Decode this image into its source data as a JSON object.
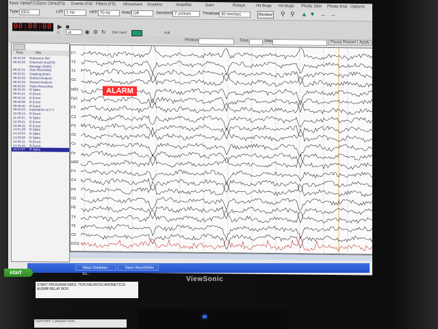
{
  "menubar": {
    "items": [
      "Epoc Opts(F2)",
      "Epoc Clinic(F3)",
      "Events (F4)",
      "Filters (F5)",
      "Movement",
      "Scatters",
      "Amplifier",
      "Gain",
      "Relays",
      "Hit Bugs",
      "Hit Bugs",
      "Photic Stim",
      "Photic End",
      "Options"
    ]
  },
  "toolbar1": {
    "type_label": "Type",
    "type_value": "EEG",
    "lff_label": "LFF",
    "lff_value": "1 Hz",
    "hff_label": "HFF",
    "hff_value": "70 Hz",
    "notch_label": "Notch",
    "notch_value": "Off",
    "sens_label": "Sensitivity",
    "sens_value": "7 uV/mm",
    "timebase_label": "Timebase",
    "timebase_value": "30 mm/sec",
    "review_button": "Review"
  },
  "toolbar2": {
    "clock": "00:00:00",
    "dropdown_value": "x0",
    "dot_label": "Dot Used",
    "full_label": "Full"
  },
  "protocol_bar": {
    "protocol_label": "Protocol",
    "time_label": "Time",
    "step_label": "Step",
    "pause_button": "Pause",
    "restart_button": "Restart",
    "apply_button": "Apply"
  },
  "event_panel": {
    "col_time": "Time",
    "col_title": "Title",
    "events": [
      {
        "time": "08:32:28",
        "title": "Reference Ref"
      },
      {
        "time": "08:32:29",
        "title": "Channels Ovp(F9)"
      },
      {
        "time": "",
        "title": "Montage (EMG)"
      },
      {
        "time": "08:32:31",
        "title": "Start Recording"
      },
      {
        "time": "08:32:31",
        "title": "Ongoing photic"
      },
      {
        "time": "08:32:32",
        "title": "Started Analyzer"
      },
      {
        "time": "08:32:33",
        "title": "Started Analyzer"
      },
      {
        "time": "08:32:35",
        "title": "Video Recording"
      },
      {
        "time": "08:35:45",
        "title": "R.Spike"
      },
      {
        "time": "08:54:21",
        "title": "R.Event"
      },
      {
        "time": "09:55:15",
        "title": "R.Event"
      },
      {
        "time": "09:58:06",
        "title": "R.Event"
      },
      {
        "time": "09:59:40",
        "title": "R.Event"
      },
      {
        "time": "09:00:26",
        "title": "Impedance at 5 V"
      },
      {
        "time": "10:39:13",
        "title": "R.Event"
      },
      {
        "time": "11:29:31",
        "title": "R.Spike"
      },
      {
        "time": "12:29:31",
        "title": "R.Event"
      },
      {
        "time": "13:46:15",
        "title": "R.Event"
      },
      {
        "time": "14:01:29",
        "title": "R.Spike"
      },
      {
        "time": "14:10:53",
        "title": "R.Spike"
      },
      {
        "time": "14:29:28",
        "title": "R.Spike"
      },
      {
        "time": "14:33:11",
        "title": "R.Event"
      },
      {
        "time": "14:45:45",
        "title": "R.Event"
      },
      {
        "time": "14:17:07",
        "title": "R.Spike"
      }
    ],
    "selected_index": 23
  },
  "alarm": "ALARM",
  "channels": [
    "F7",
    "T3",
    "T5",
    "O1",
    "M01",
    "Fp1",
    "F3",
    "C3",
    "P3",
    "O1",
    "Cz",
    "Pz",
    "M02",
    "F4",
    "C4",
    "P4",
    "O2",
    "F8",
    "T4",
    "T6",
    "O2",
    "ECG"
  ],
  "taskbar": {
    "start": "start",
    "tasks": [
      "Natus Database - Ex...",
      "Natus NeuroWorks"
    ]
  },
  "brand": "ViewSonic",
  "note": "START PROGRAM EMOL TION NEUROSCANOMETICS/ ALBMB RELAY BOX",
  "sticker": "SUPPORT: 1 (800)487-0100 ..."
}
